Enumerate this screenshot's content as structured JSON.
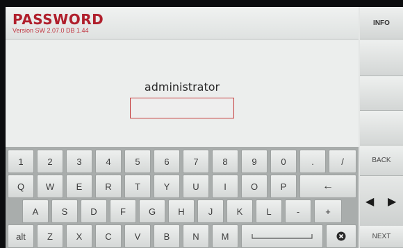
{
  "header": {
    "title": "PASSWORD",
    "version": "Version SW 2.07.0 DB 1.44"
  },
  "login": {
    "username": "administrator",
    "password_value": ""
  },
  "keyboard": {
    "rows": [
      [
        "1",
        "2",
        "3",
        "4",
        "5",
        "6",
        "7",
        "8",
        "9",
        "0",
        ".",
        "/"
      ],
      [
        "Q",
        "W",
        "E",
        "R",
        "T",
        "Y",
        "U",
        "I",
        "O",
        "P",
        "←"
      ],
      [
        "A",
        "S",
        "D",
        "F",
        "G",
        "H",
        "J",
        "K",
        "L",
        "-",
        "+"
      ],
      [
        "alt",
        "Z",
        "X",
        "C",
        "V",
        "B",
        "N",
        "M",
        "",
        ""
      ]
    ]
  },
  "sidebar": {
    "info_label": "INFO",
    "back_label": "BACK",
    "next_label": "NEXT",
    "left_arrow": "◀",
    "right_arrow": "▶"
  },
  "icons": {
    "backspace": "backspace-icon",
    "space": "spacebar-icon",
    "arrows": [
      "left-arrow-icon",
      "right-arrow-icon"
    ]
  },
  "colors": {
    "title_red": "#b01f2c",
    "input_border": "#c43a3a"
  }
}
